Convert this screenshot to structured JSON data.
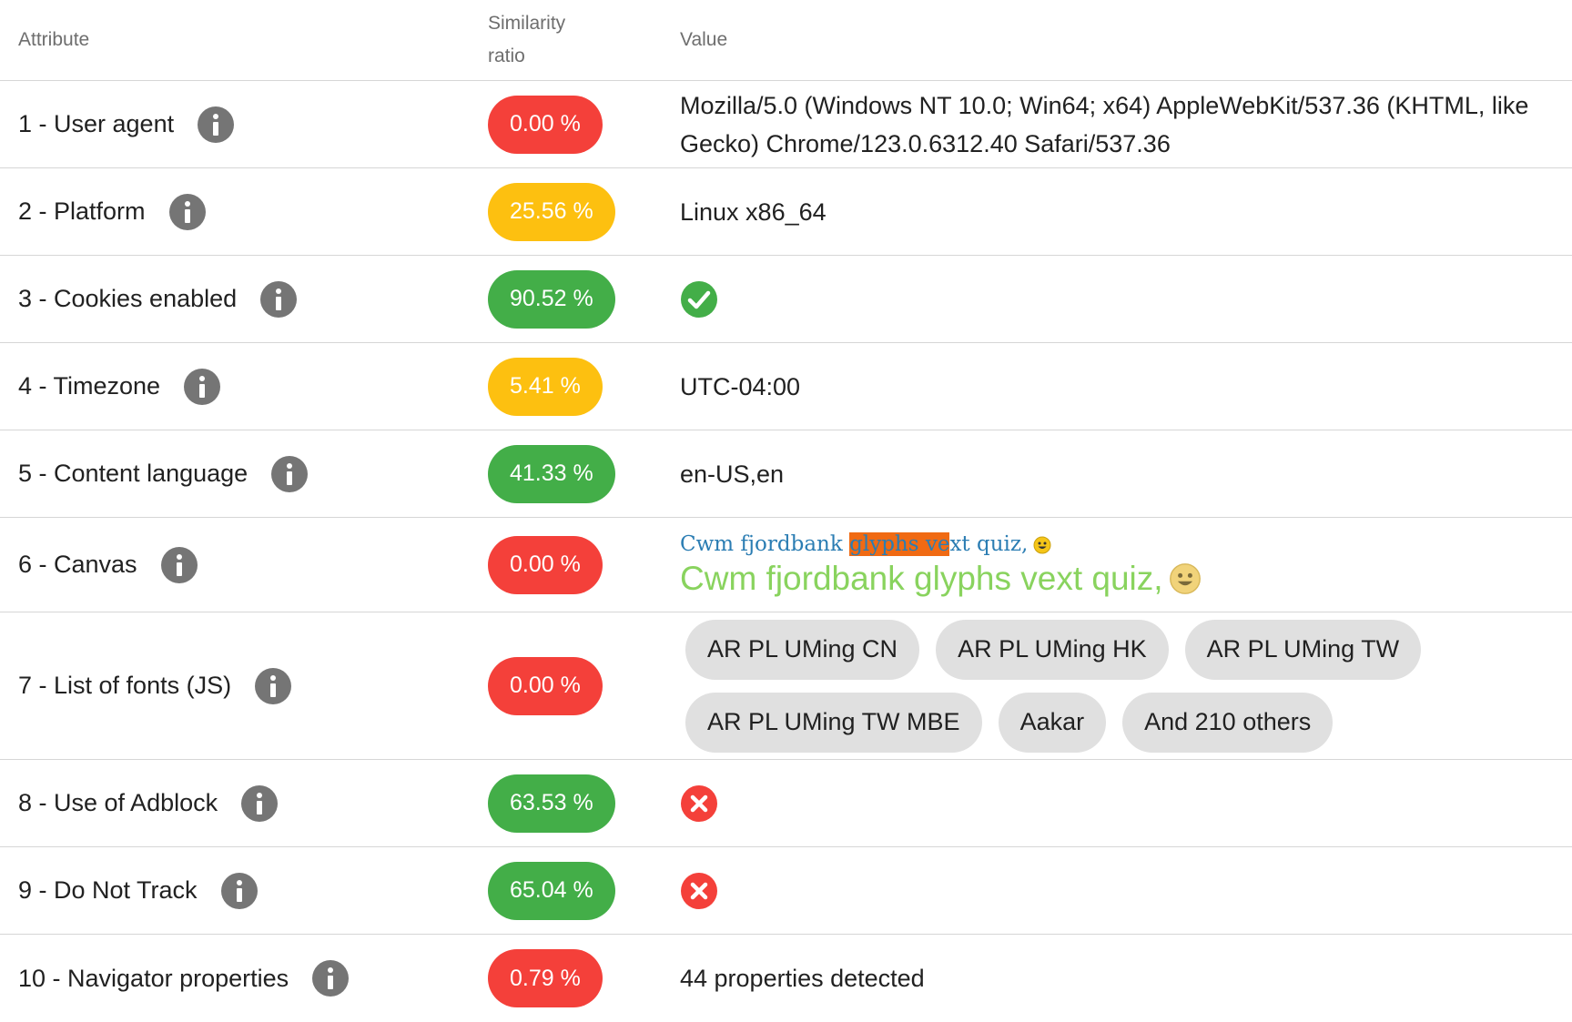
{
  "header": {
    "attribute": "Attribute",
    "similarity_line1": "Similarity",
    "similarity_line2": "ratio",
    "value": "Value"
  },
  "colors": {
    "red": "#f4403a",
    "amber": "#fdc010",
    "green": "#43ae48",
    "info": "#757575"
  },
  "rows": [
    {
      "label": "1 - User agent",
      "ratio": "0.00 %",
      "ratio_color": "red",
      "value": "Mozilla/5.0 (Windows NT 10.0; Win64; x64) AppleWebKit/537.36 (KHTML, like Gecko) Chrome/123.0.6312.40 Safari/537.36"
    },
    {
      "label": "2 - Platform",
      "ratio": "25.56 %",
      "ratio_color": "amber",
      "value": "Linux x86_64"
    },
    {
      "label": "3 - Cookies enabled",
      "ratio": "90.52 %",
      "ratio_color": "green",
      "value_icon": "check-circle-icon"
    },
    {
      "label": "4 - Timezone",
      "ratio": "5.41 %",
      "ratio_color": "amber",
      "value": "UTC-04:00"
    },
    {
      "label": "5 - Content language",
      "ratio": "41.33 %",
      "ratio_color": "green",
      "value": "en-US,en"
    },
    {
      "label": "6 - Canvas",
      "ratio": "0.00 %",
      "ratio_color": "red",
      "canvas_small_a": "Cwm fjordbank ",
      "canvas_small_b": "glyphs ve",
      "canvas_small_c": "xt quiz,",
      "canvas_big": "Cwm fjordbank glyphs vext quiz,"
    },
    {
      "label": "7 - List of fonts (JS)",
      "ratio": "0.00 %",
      "ratio_color": "red",
      "fonts": [
        "AR PL UMing CN",
        "AR PL UMing HK",
        "AR PL UMing TW",
        "AR PL UMing TW MBE",
        "Aakar",
        "And 210 others"
      ]
    },
    {
      "label": "8 - Use of Adblock",
      "ratio": "63.53 %",
      "ratio_color": "green",
      "value_icon": "cross-circle-icon"
    },
    {
      "label": "9 - Do Not Track",
      "ratio": "65.04 %",
      "ratio_color": "green",
      "value_icon": "cross-circle-icon"
    },
    {
      "label": "10 - Navigator properties",
      "ratio": "0.79 %",
      "ratio_color": "red",
      "value": "44 properties detected"
    }
  ]
}
